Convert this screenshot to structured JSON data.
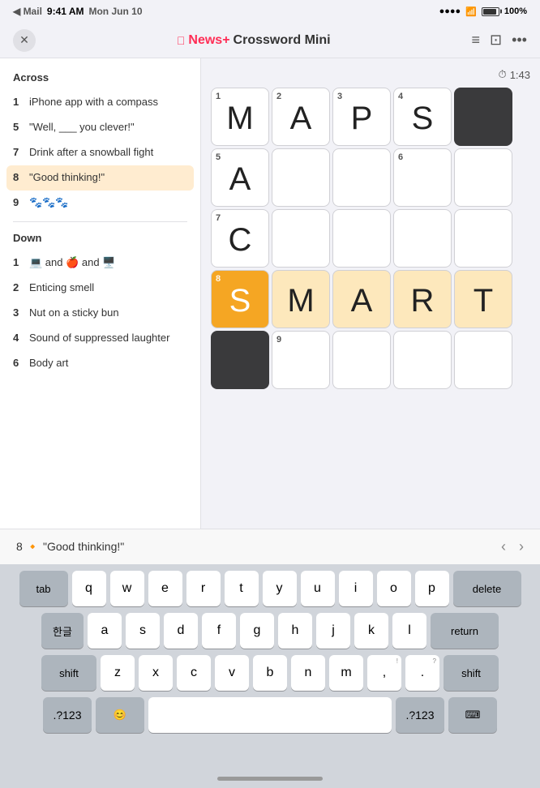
{
  "statusBar": {
    "back": "◀ Mail",
    "time": "9:41 AM",
    "date": "Mon Jun 10",
    "signal": "●●●●●",
    "wifi": "wifi",
    "battery": "100%"
  },
  "navBar": {
    "closeLabel": "✕",
    "titleApple": "",
    "titleNewsPlus": "News+",
    "titleCrossword": " Crossword Mini",
    "listIcon": "≡",
    "screenIcon": "⊡",
    "moreIcon": "•••"
  },
  "timer": {
    "icon": "⏱",
    "value": "1:43"
  },
  "clues": {
    "acrossTitle": "Across",
    "acrossItems": [
      {
        "num": "1",
        "text": "iPhone app with a compass"
      },
      {
        "num": "5",
        "text": "\"Well, ___ you clever!\""
      },
      {
        "num": "7",
        "text": "Drink after a snowball fight"
      },
      {
        "num": "8",
        "text": "\"Good thinking!\"",
        "active": true
      },
      {
        "num": "9",
        "text": "🐾🐾🐾"
      }
    ],
    "downTitle": "Down",
    "downItems": [
      {
        "num": "1",
        "text": "💻 and 🍎 and 🖥️"
      },
      {
        "num": "2",
        "text": "Enticing smell"
      },
      {
        "num": "3",
        "text": "Nut on a sticky bun"
      },
      {
        "num": "4",
        "text": "Sound of suppressed laughter"
      },
      {
        "num": "6",
        "text": "Body art"
      }
    ]
  },
  "grid": {
    "cells": [
      {
        "row": 0,
        "col": 0,
        "num": "1",
        "letter": "M",
        "state": "normal"
      },
      {
        "row": 0,
        "col": 1,
        "num": "2",
        "letter": "A",
        "state": "normal"
      },
      {
        "row": 0,
        "col": 2,
        "num": "3",
        "letter": "P",
        "state": "normal"
      },
      {
        "row": 0,
        "col": 3,
        "num": "4",
        "letter": "S",
        "state": "normal"
      },
      {
        "row": 0,
        "col": 4,
        "num": "",
        "letter": "",
        "state": "black"
      },
      {
        "row": 1,
        "col": 0,
        "num": "5",
        "letter": "A",
        "state": "normal"
      },
      {
        "row": 1,
        "col": 1,
        "num": "",
        "letter": "",
        "state": "normal"
      },
      {
        "row": 1,
        "col": 2,
        "num": "",
        "letter": "",
        "state": "normal"
      },
      {
        "row": 1,
        "col": 3,
        "num": "6",
        "letter": "",
        "state": "normal"
      },
      {
        "row": 1,
        "col": 4,
        "num": "",
        "letter": "",
        "state": "normal"
      },
      {
        "row": 2,
        "col": 0,
        "num": "7",
        "letter": "C",
        "state": "normal"
      },
      {
        "row": 2,
        "col": 1,
        "num": "",
        "letter": "",
        "state": "normal"
      },
      {
        "row": 2,
        "col": 2,
        "num": "",
        "letter": "",
        "state": "normal"
      },
      {
        "row": 2,
        "col": 3,
        "num": "",
        "letter": "",
        "state": "normal"
      },
      {
        "row": 2,
        "col": 4,
        "num": "",
        "letter": "",
        "state": "normal"
      },
      {
        "row": 3,
        "col": 0,
        "num": "8",
        "letter": "S",
        "state": "active"
      },
      {
        "row": 3,
        "col": 1,
        "num": "",
        "letter": "M",
        "state": "highlighted"
      },
      {
        "row": 3,
        "col": 2,
        "num": "",
        "letter": "A",
        "state": "highlighted"
      },
      {
        "row": 3,
        "col": 3,
        "num": "",
        "letter": "R",
        "state": "highlighted"
      },
      {
        "row": 3,
        "col": 4,
        "num": "",
        "letter": "T",
        "state": "highlighted"
      },
      {
        "row": 4,
        "col": 0,
        "num": "",
        "letter": "",
        "state": "black"
      },
      {
        "row": 4,
        "col": 1,
        "num": "9",
        "letter": "",
        "state": "normal"
      },
      {
        "row": 4,
        "col": 2,
        "num": "",
        "letter": "",
        "state": "normal"
      },
      {
        "row": 4,
        "col": 3,
        "num": "",
        "letter": "",
        "state": "normal"
      },
      {
        "row": 4,
        "col": 4,
        "num": "",
        "letter": "",
        "state": "normal"
      }
    ]
  },
  "clueHint": {
    "clueRef": "8",
    "icon": "🔸",
    "text": "\"Good thinking!\""
  },
  "keyboard": {
    "row1": [
      {
        "label": "tab",
        "special": true,
        "class": "tab"
      },
      {
        "label": "q",
        "sub": ""
      },
      {
        "label": "w",
        "sub": ""
      },
      {
        "label": "e",
        "sub": ""
      },
      {
        "label": "r",
        "sub": ""
      },
      {
        "label": "t",
        "sub": ""
      },
      {
        "label": "y",
        "sub": ""
      },
      {
        "label": "u",
        "sub": ""
      },
      {
        "label": "i",
        "sub": ""
      },
      {
        "label": "o",
        "sub": ""
      },
      {
        "label": "p",
        "sub": ""
      },
      {
        "label": "delete",
        "special": true,
        "class": "delete-key"
      }
    ],
    "row2": [
      {
        "label": "한글",
        "special": true,
        "class": "lang-key"
      },
      {
        "label": "a",
        "sub": ""
      },
      {
        "label": "s",
        "sub": ""
      },
      {
        "label": "d",
        "sub": ""
      },
      {
        "label": "f",
        "sub": ""
      },
      {
        "label": "g",
        "sub": ""
      },
      {
        "label": "h",
        "sub": ""
      },
      {
        "label": "j",
        "sub": ""
      },
      {
        "label": "k",
        "sub": ""
      },
      {
        "label": "l",
        "sub": ""
      },
      {
        "label": "return",
        "special": true,
        "class": "return-key"
      }
    ],
    "row3": [
      {
        "label": "shift",
        "special": true,
        "class": "shift-key"
      },
      {
        "label": "z",
        "sub": ""
      },
      {
        "label": "x",
        "sub": ""
      },
      {
        "label": "c",
        "sub": ""
      },
      {
        "label": "v",
        "sub": ""
      },
      {
        "label": "b",
        "sub": ""
      },
      {
        "label": "n",
        "sub": ""
      },
      {
        "label": "m",
        "sub": ""
      },
      {
        "label": ",",
        "sub": "!"
      },
      {
        "label": ".",
        "sub": "?"
      },
      {
        "label": "shift",
        "special": true,
        "class": "shift-key"
      }
    ],
    "row4": [
      {
        "label": ".?123",
        "special": true,
        "class": "number-key"
      },
      {
        "label": "😊",
        "special": true,
        "class": "emoji-key"
      },
      {
        "label": "space",
        "class": "space-bar"
      },
      {
        "label": ".?123",
        "special": true,
        "class": "number-key"
      },
      {
        "label": "⌨",
        "special": true,
        "class": "emoji-key"
      }
    ]
  }
}
